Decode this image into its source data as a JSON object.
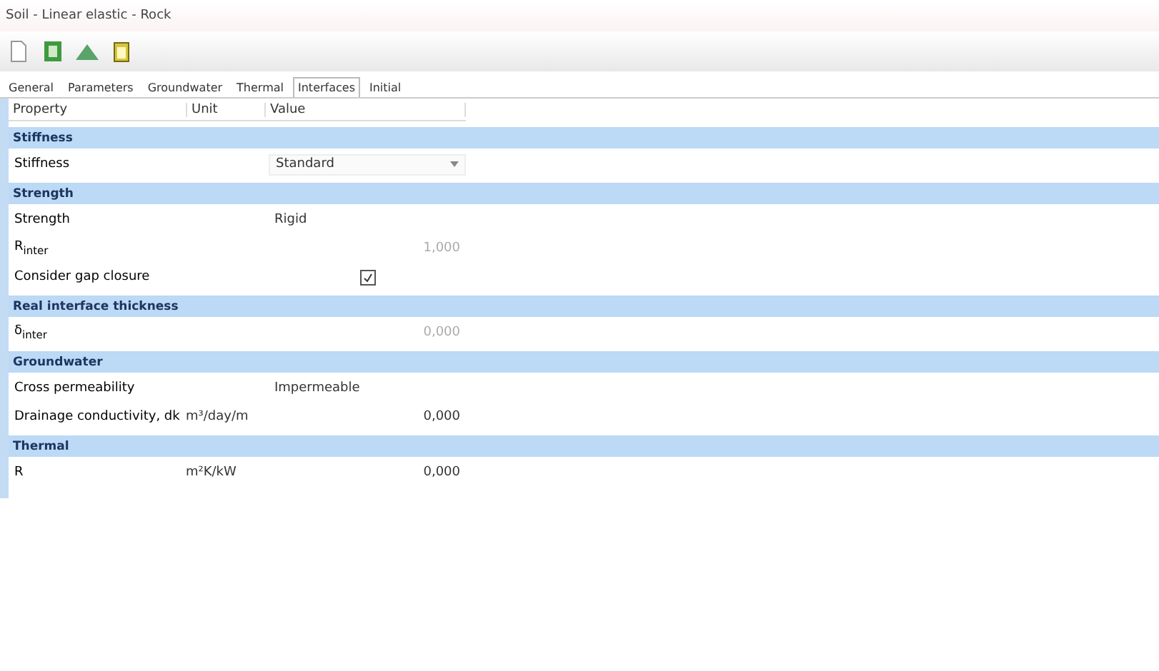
{
  "window": {
    "title": "Soil - Linear elastic - Rock"
  },
  "toolbar": {
    "buttons": [
      {
        "kind": "page"
      },
      {
        "kind": "sheet"
      },
      {
        "kind": "mountain"
      },
      {
        "kind": "clipboard"
      }
    ]
  },
  "tabs": [
    {
      "label": "General",
      "selected": false
    },
    {
      "label": "Parameters",
      "selected": false
    },
    {
      "label": "Groundwater",
      "selected": false
    },
    {
      "label": "Thermal",
      "selected": false
    },
    {
      "label": "Interfaces",
      "selected": true
    },
    {
      "label": "Initial",
      "selected": false
    }
  ],
  "table": {
    "columns": [
      "Property",
      "Unit",
      "Value"
    ],
    "sections": [
      {
        "title": "Stiffness",
        "rows": [
          {
            "kind": "dropdown",
            "property": "Stiffness",
            "value": "Standard"
          }
        ]
      },
      {
        "title": "Strength",
        "rows": [
          {
            "kind": "text",
            "property": "Strength",
            "value": "Rigid"
          },
          {
            "kind": "number",
            "property": "R$_{inter}$",
            "value": "1,000",
            "disabled": true
          },
          {
            "kind": "checkbox",
            "property": "Consider gap closure",
            "checked": true
          }
        ]
      },
      {
        "title": "Real interface thickness",
        "rows": [
          {
            "kind": "number",
            "property": "δ$_{inter}$",
            "value": "0,000",
            "disabled": true
          }
        ]
      },
      {
        "title": "Groundwater",
        "rows": [
          {
            "kind": "text",
            "property": "Cross permeability",
            "value": "Impermeable"
          },
          {
            "kind": "number",
            "property": "Drainage conductivity, dk",
            "unit": "m³/day/m",
            "value": "0,000",
            "disabled": false
          }
        ]
      },
      {
        "title": "Thermal",
        "rows": [
          {
            "kind": "number",
            "property": "R",
            "unit": "m²K/kW",
            "value": "0,000",
            "disabled": false
          }
        ]
      }
    ]
  }
}
